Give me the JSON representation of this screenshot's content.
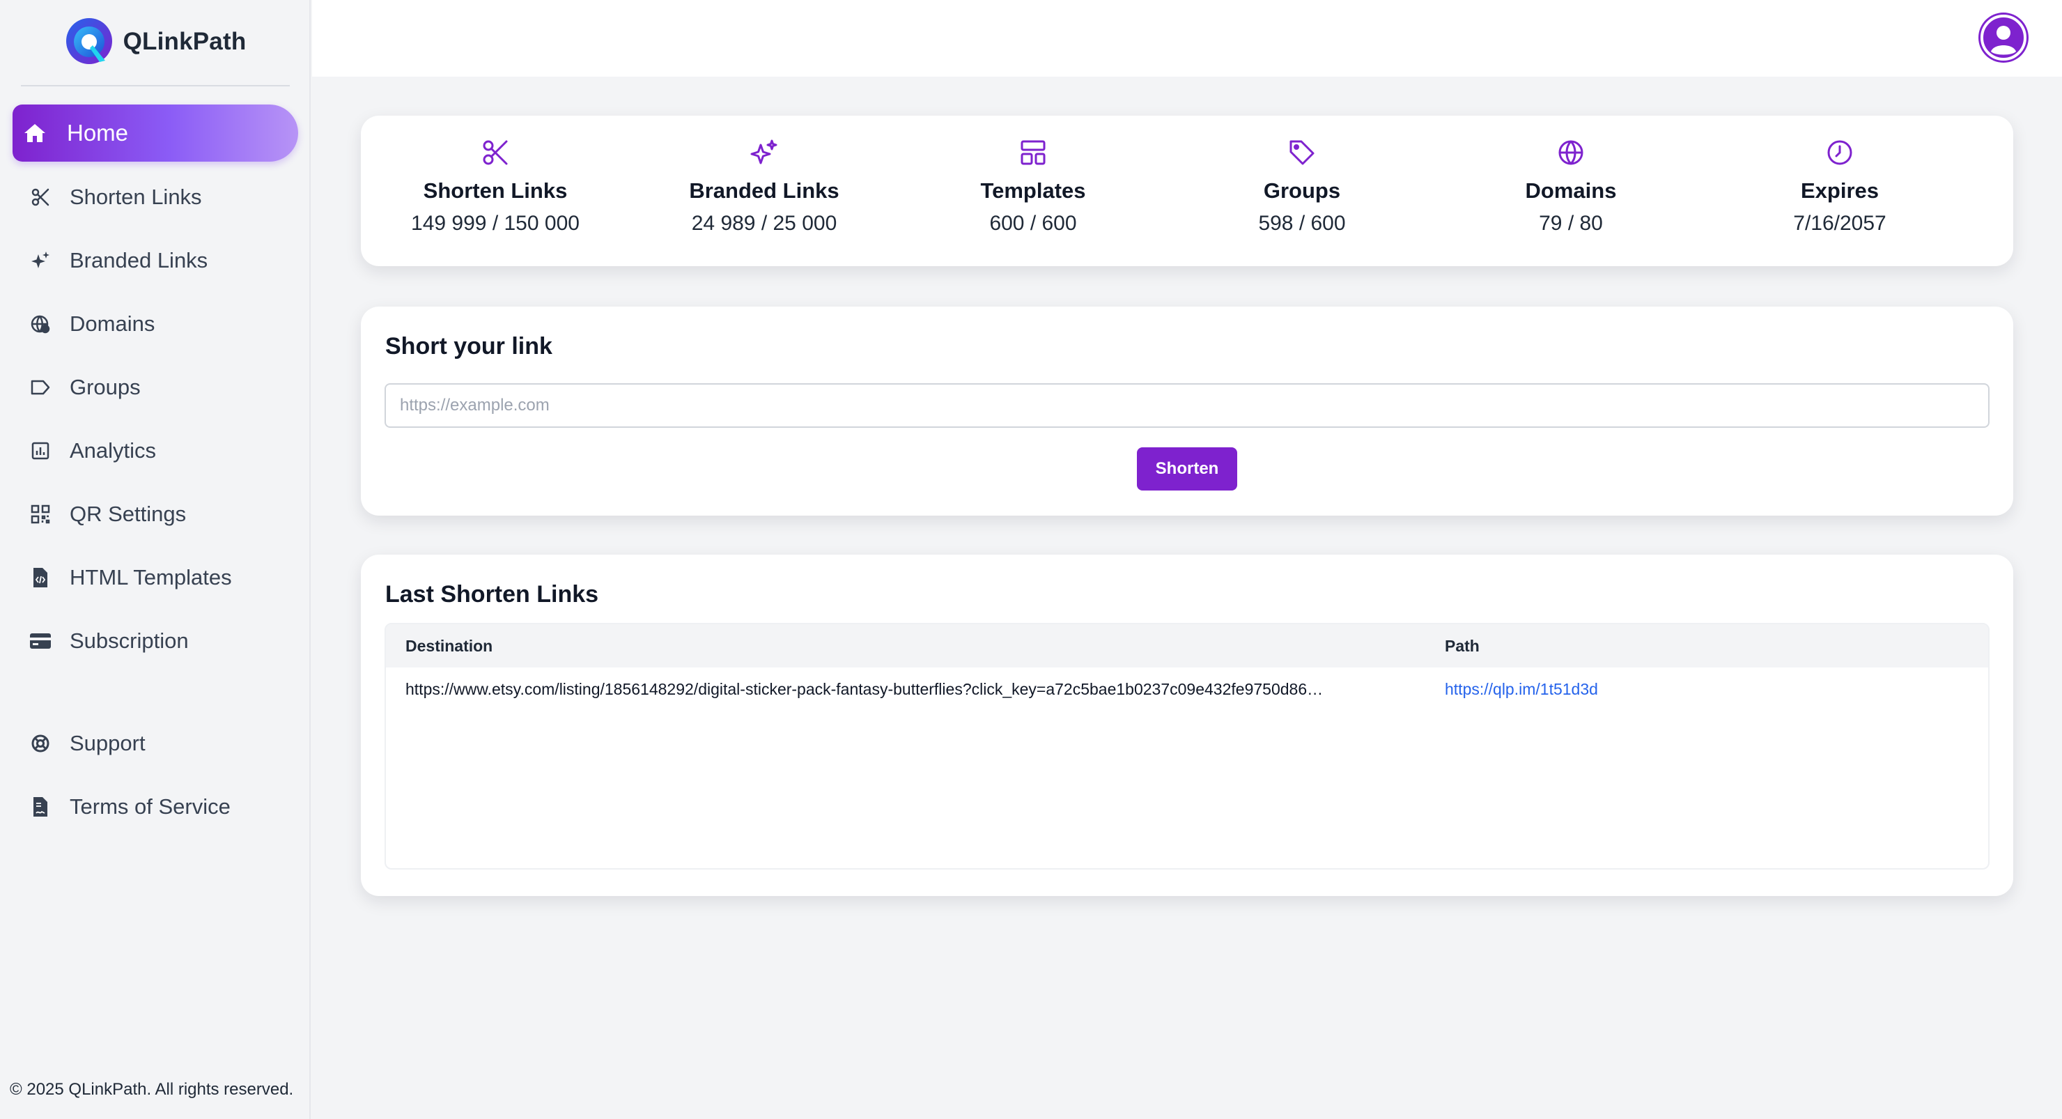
{
  "app": {
    "name": "QLinkPath",
    "accent": "#7e22ce",
    "link_color": "#2563eb"
  },
  "sidebar": {
    "items": [
      {
        "label": "Home",
        "icon": "home-icon",
        "active": true
      },
      {
        "label": "Shorten Links",
        "icon": "scissors-icon"
      },
      {
        "label": "Branded Links",
        "icon": "sparkles-icon"
      },
      {
        "label": "Domains",
        "icon": "globe-icon"
      },
      {
        "label": "Groups",
        "icon": "label-tag-icon"
      },
      {
        "label": "Analytics",
        "icon": "bar-chart-icon"
      },
      {
        "label": "QR Settings",
        "icon": "qr-code-icon"
      },
      {
        "label": "HTML Templates",
        "icon": "file-code-icon"
      },
      {
        "label": "Subscription",
        "icon": "credit-card-icon"
      },
      {
        "label": "Support",
        "icon": "lifebuoy-icon"
      },
      {
        "label": "Terms of Service",
        "icon": "file-contract-icon"
      }
    ],
    "footer": "© 2025 QLinkPath. All rights reserved."
  },
  "stats": [
    {
      "title": "Shorten Links",
      "value": "149 999 / 150 000",
      "icon": "scissors-icon"
    },
    {
      "title": "Branded Links",
      "value": "24 989 / 25 000",
      "icon": "sparkles-icon"
    },
    {
      "title": "Templates",
      "value": "600 / 600",
      "icon": "layout-icon"
    },
    {
      "title": "Groups",
      "value": "598 / 600",
      "icon": "tag-icon"
    },
    {
      "title": "Domains",
      "value": "79 / 80",
      "icon": "globe-icon"
    },
    {
      "title": "Expires",
      "value": "7/16/2057",
      "icon": "clock-icon"
    }
  ],
  "shorten": {
    "title": "Short your link",
    "placeholder": "https://example.com",
    "value": "",
    "button": "Shorten"
  },
  "last_links": {
    "title": "Last Shorten Links",
    "columns": [
      "Destination",
      "Path"
    ],
    "rows": [
      {
        "destination": "https://www.etsy.com/listing/1856148292/digital-sticker-pack-fantasy-butterflies?click_key=a72c5bae1b0237c09e432fe9750d86…",
        "path": "https://qlp.im/1t51d3d"
      }
    ]
  }
}
